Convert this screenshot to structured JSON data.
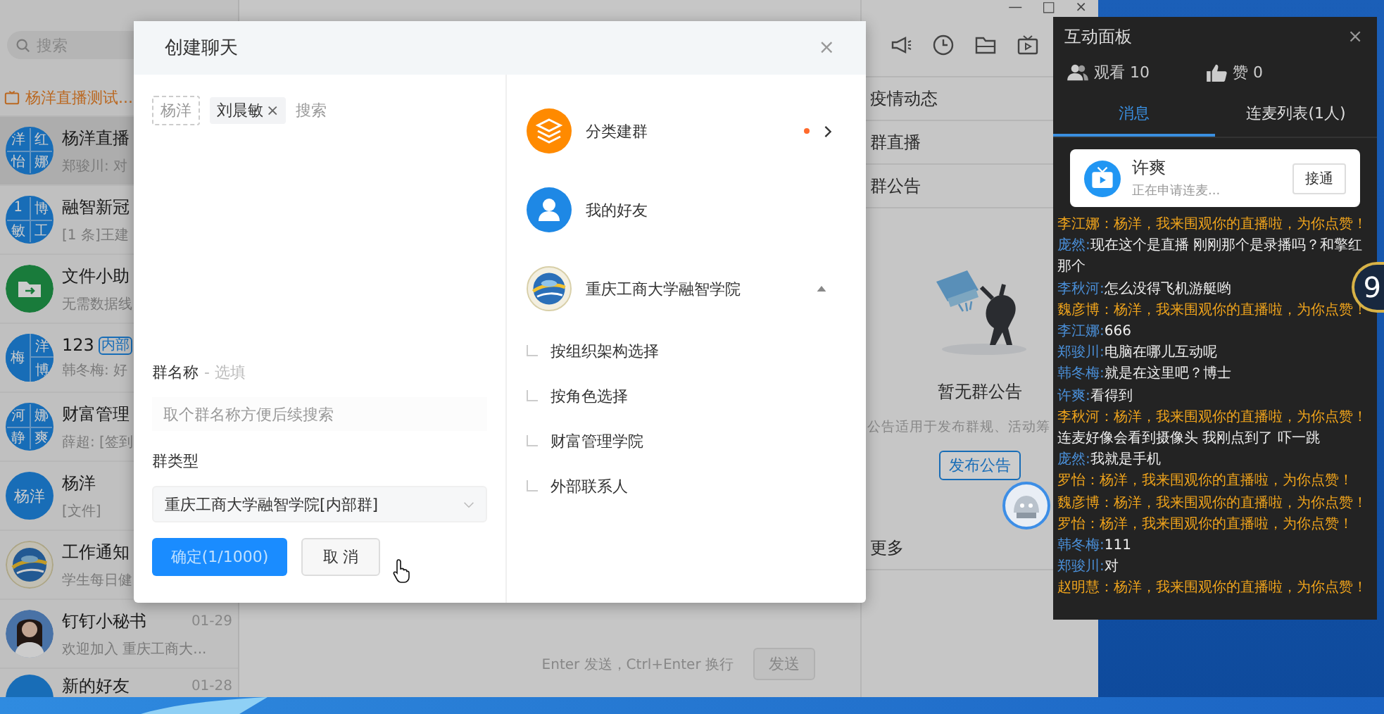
{
  "app": {
    "window_controls": [
      "—",
      "□",
      "×"
    ],
    "search": {
      "placeholder": "搜索"
    },
    "live_banner": "杨洋直播测试...",
    "chats": [
      {
        "title": "杨洋直播",
        "preview": "郑骏川: 对",
        "selected": true,
        "avatar": {
          "kind": "grid",
          "chars": [
            "洋",
            "红",
            "怡",
            "娜"
          ]
        }
      },
      {
        "title": "融智新冠",
        "preview": "[1 条]王建",
        "selected": false,
        "avatar": {
          "kind": "grid",
          "chars": [
            "1",
            "博",
            "敏",
            "工"
          ]
        }
      },
      {
        "title": "文件小助",
        "preview": "无需数据线",
        "selected": false,
        "avatar": {
          "kind": "folder"
        }
      },
      {
        "title": "123",
        "badge": "内部",
        "preview": "韩冬梅: 好",
        "selected": false,
        "avatar": {
          "kind": "grid3",
          "chars": [
            "梅",
            "洋",
            "博"
          ]
        }
      },
      {
        "title": "财富管理",
        "preview": "薛超: [签到",
        "selected": false,
        "avatar": {
          "kind": "grid",
          "chars": [
            "河",
            "娜",
            "静",
            "爽"
          ]
        }
      },
      {
        "title": "杨洋",
        "preview": "[文件]",
        "selected": false,
        "avatar": {
          "kind": "text",
          "text": "杨洋"
        }
      },
      {
        "title": "工作通知",
        "preview": "学生每日健",
        "selected": false,
        "avatar": {
          "kind": "logo"
        }
      },
      {
        "title": "钉钉小秘书",
        "time": "01-29",
        "preview": "欢迎加入 重庆工商大...",
        "selected": false,
        "avatar": {
          "kind": "person"
        }
      },
      {
        "title": "新的好友",
        "time": "01-28",
        "selected": false,
        "avatar": {
          "kind": "plain"
        }
      }
    ],
    "sections": [
      "疫情动态",
      "群直播",
      "群公告"
    ],
    "notice": {
      "title": "暂无群公告",
      "description": "公告适用于发布群规、活动筹",
      "button": "发布公告"
    },
    "more": "更多",
    "composer": {
      "hint": "Enter 发送，Ctrl+Enter 换行",
      "send": "发送"
    }
  },
  "dialog": {
    "title": "创建聊天",
    "close": "×",
    "members": [
      {
        "name": "杨洋",
        "fixed": true
      },
      {
        "name": "刘晨敏",
        "fixed": false,
        "remove": "×"
      }
    ],
    "search_placeholder": "搜索",
    "name_label": "群名称",
    "name_optional": "- 选填",
    "name_placeholder": "取个群名称方便后续搜索",
    "type_label": "群类型",
    "type_value": "重庆工商大学融智学院[内部群]",
    "confirm": "确定(1/1000)",
    "cancel": "取 消",
    "sources": [
      {
        "kind": "category",
        "label": "分类建群",
        "dot": true
      },
      {
        "kind": "friends",
        "label": "我的好友",
        "dot": false
      },
      {
        "kind": "org",
        "label": "重庆工商大学融智学院",
        "dot": false,
        "expanded": true,
        "children": [
          {
            "label": "按组织架构选择"
          },
          {
            "label": "按角色选择"
          },
          {
            "label": "财富管理学院"
          },
          {
            "label": "外部联系人"
          }
        ]
      }
    ]
  },
  "panel": {
    "title": "互动面板",
    "close": "×",
    "viewers": "观看 10",
    "likes": "赞 0",
    "tabs": [
      {
        "label": "消息",
        "selected": true
      },
      {
        "label": "连麦列表(1人)",
        "selected": false
      }
    ],
    "request": {
      "name": "许爽",
      "status": "正在申请连麦...",
      "action": "接通"
    },
    "messages": [
      {
        "kind": "like",
        "text": "李江娜：杨洋，我来围观你的直播啦，为你点赞！"
      },
      {
        "kind": "chat",
        "name": "庞然:",
        "text": "现在这个是直播 刚刚那个是录播吗？和擎红那个"
      },
      {
        "kind": "chat",
        "name": "李秋河:",
        "text": "怎么没得飞机游艇哟"
      },
      {
        "kind": "like",
        "text": "魏彦博：杨洋，我来围观你的直播啦，为你点赞！"
      },
      {
        "kind": "chat",
        "name": "李江娜:",
        "text": "666"
      },
      {
        "kind": "chat",
        "name": "郑骏川:",
        "text": "电脑在哪儿互动呢"
      },
      {
        "kind": "chat",
        "name": "韩冬梅:",
        "text": "就是在这里吧？博士"
      },
      {
        "kind": "chat",
        "name": "许爽:",
        "text": "看得到"
      },
      {
        "kind": "like",
        "text": "李秋河：杨洋，我来围观你的直播啦，为你点赞！"
      },
      {
        "kind": "chat",
        "text": "连麦好像会看到摄像头 我刚点到了 吓一跳"
      },
      {
        "kind": "chat",
        "name": "庞然:",
        "text": "我就是手机"
      },
      {
        "kind": "like",
        "text": "罗怡：杨洋，我来围观你的直播啦，为你点赞！"
      },
      {
        "kind": "like",
        "text": "魏彦博：杨洋，我来围观你的直播啦，为你点赞！"
      },
      {
        "kind": "like",
        "text": "罗怡：杨洋，我来围观你的直播啦，为你点赞！"
      },
      {
        "kind": "chat",
        "name": "韩冬梅:",
        "text": "111"
      },
      {
        "kind": "chat",
        "name": "郑骏川:",
        "text": "对"
      },
      {
        "kind": "like",
        "text": "赵明慧：杨洋，我来围观你的直播啦，为你点赞！"
      }
    ]
  },
  "score_bubble": "9"
}
